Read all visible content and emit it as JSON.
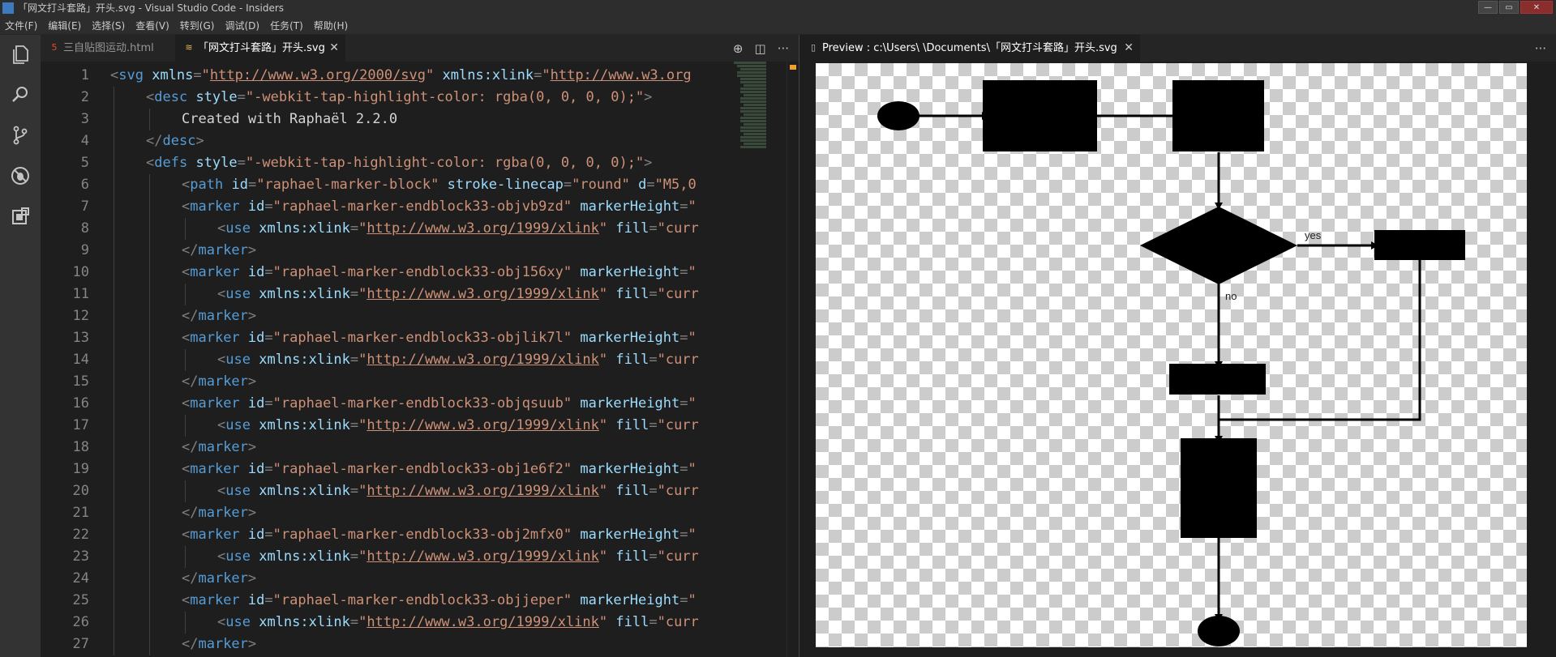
{
  "window": {
    "title": "「网文打斗套路」开头.svg - Visual Studio Code - Insiders",
    "buttons": [
      "—",
      "▭",
      "✕"
    ]
  },
  "menu": [
    "文件(F)",
    "编辑(E)",
    "选择(S)",
    "查看(V)",
    "转到(G)",
    "调试(D)",
    "任务(T)",
    "帮助(H)"
  ],
  "activity_icons": [
    "files-icon",
    "search-icon",
    "source-control-icon",
    "debug-icon",
    "extensions-icon"
  ],
  "editor": {
    "tabs": [
      {
        "label": "三自贴图运动.html",
        "icon": "html5-icon",
        "active": false
      },
      {
        "label": "「网文打斗套路」开头.svg",
        "icon": "svg-file-icon",
        "active": true
      }
    ],
    "actions": [
      "⊕",
      "◫",
      "···"
    ],
    "lines": [
      {
        "n": "1",
        "indent": 0,
        "tokens": [
          [
            "pun",
            "<"
          ],
          [
            "tag",
            "svg"
          ],
          [
            "txt",
            " "
          ],
          [
            "attr",
            "xmlns"
          ],
          [
            "pun",
            "="
          ],
          [
            "str",
            "\""
          ],
          [
            "url",
            "http://www.w3.org/2000/svg"
          ],
          [
            "str",
            "\""
          ],
          [
            "txt",
            " "
          ],
          [
            "attr",
            "xmlns:xlink"
          ],
          [
            "pun",
            "="
          ],
          [
            "str",
            "\""
          ],
          [
            "url",
            "http://www.w3.org"
          ]
        ]
      },
      {
        "n": "2",
        "indent": 1,
        "tokens": [
          [
            "pun",
            "<"
          ],
          [
            "tag",
            "desc"
          ],
          [
            "txt",
            " "
          ],
          [
            "attr",
            "style"
          ],
          [
            "pun",
            "="
          ],
          [
            "str",
            "\"-webkit-tap-highlight-color: rgba(0, 0, 0, 0);\""
          ],
          [
            "pun",
            ">"
          ]
        ]
      },
      {
        "n": "3",
        "indent": 2,
        "tokens": [
          [
            "txt",
            "Created with Raphaël 2.2.0"
          ]
        ]
      },
      {
        "n": "4",
        "indent": 1,
        "tokens": [
          [
            "pun",
            "</"
          ],
          [
            "tag",
            "desc"
          ],
          [
            "pun",
            ">"
          ]
        ]
      },
      {
        "n": "5",
        "indent": 1,
        "tokens": [
          [
            "pun",
            "<"
          ],
          [
            "tag",
            "defs"
          ],
          [
            "txt",
            " "
          ],
          [
            "attr",
            "style"
          ],
          [
            "pun",
            "="
          ],
          [
            "str",
            "\"-webkit-tap-highlight-color: rgba(0, 0, 0, 0);\""
          ],
          [
            "pun",
            ">"
          ]
        ]
      },
      {
        "n": "6",
        "indent": 2,
        "tokens": [
          [
            "pun",
            "<"
          ],
          [
            "tag",
            "path"
          ],
          [
            "txt",
            " "
          ],
          [
            "attr",
            "id"
          ],
          [
            "pun",
            "="
          ],
          [
            "str",
            "\"raphael-marker-block\""
          ],
          [
            "txt",
            " "
          ],
          [
            "attr",
            "stroke-linecap"
          ],
          [
            "pun",
            "="
          ],
          [
            "str",
            "\"round\""
          ],
          [
            "txt",
            " "
          ],
          [
            "attr",
            "d"
          ],
          [
            "pun",
            "="
          ],
          [
            "str",
            "\"M5,0"
          ]
        ]
      },
      {
        "n": "7",
        "indent": 2,
        "tokens": [
          [
            "pun",
            "<"
          ],
          [
            "tag",
            "marker"
          ],
          [
            "txt",
            " "
          ],
          [
            "attr",
            "id"
          ],
          [
            "pun",
            "="
          ],
          [
            "str",
            "\"raphael-marker-endblock33-objvb9zd\""
          ],
          [
            "txt",
            " "
          ],
          [
            "attr",
            "markerHeight"
          ],
          [
            "pun",
            "="
          ],
          [
            "str",
            "\""
          ]
        ]
      },
      {
        "n": "8",
        "indent": 3,
        "tokens": [
          [
            "pun",
            "<"
          ],
          [
            "tag",
            "use"
          ],
          [
            "txt",
            " "
          ],
          [
            "attr",
            "xmlns:xlink"
          ],
          [
            "pun",
            "="
          ],
          [
            "str",
            "\""
          ],
          [
            "url",
            "http://www.w3.org/1999/xlink"
          ],
          [
            "str",
            "\""
          ],
          [
            "txt",
            " "
          ],
          [
            "attr",
            "fill"
          ],
          [
            "pun",
            "="
          ],
          [
            "str",
            "\"curr"
          ]
        ]
      },
      {
        "n": "9",
        "indent": 2,
        "tokens": [
          [
            "pun",
            "</"
          ],
          [
            "tag",
            "marker"
          ],
          [
            "pun",
            ">"
          ]
        ]
      },
      {
        "n": "10",
        "indent": 2,
        "tokens": [
          [
            "pun",
            "<"
          ],
          [
            "tag",
            "marker"
          ],
          [
            "txt",
            " "
          ],
          [
            "attr",
            "id"
          ],
          [
            "pun",
            "="
          ],
          [
            "str",
            "\"raphael-marker-endblock33-obj156xy\""
          ],
          [
            "txt",
            " "
          ],
          [
            "attr",
            "markerHeight"
          ],
          [
            "pun",
            "="
          ],
          [
            "str",
            "\""
          ]
        ]
      },
      {
        "n": "11",
        "indent": 3,
        "tokens": [
          [
            "pun",
            "<"
          ],
          [
            "tag",
            "use"
          ],
          [
            "txt",
            " "
          ],
          [
            "attr",
            "xmlns:xlink"
          ],
          [
            "pun",
            "="
          ],
          [
            "str",
            "\""
          ],
          [
            "url",
            "http://www.w3.org/1999/xlink"
          ],
          [
            "str",
            "\""
          ],
          [
            "txt",
            " "
          ],
          [
            "attr",
            "fill"
          ],
          [
            "pun",
            "="
          ],
          [
            "str",
            "\"curr"
          ]
        ]
      },
      {
        "n": "12",
        "indent": 2,
        "tokens": [
          [
            "pun",
            "</"
          ],
          [
            "tag",
            "marker"
          ],
          [
            "pun",
            ">"
          ]
        ]
      },
      {
        "n": "13",
        "indent": 2,
        "tokens": [
          [
            "pun",
            "<"
          ],
          [
            "tag",
            "marker"
          ],
          [
            "txt",
            " "
          ],
          [
            "attr",
            "id"
          ],
          [
            "pun",
            "="
          ],
          [
            "str",
            "\"raphael-marker-endblock33-objlik7l\""
          ],
          [
            "txt",
            " "
          ],
          [
            "attr",
            "markerHeight"
          ],
          [
            "pun",
            "="
          ],
          [
            "str",
            "\""
          ]
        ]
      },
      {
        "n": "14",
        "indent": 3,
        "tokens": [
          [
            "pun",
            "<"
          ],
          [
            "tag",
            "use"
          ],
          [
            "txt",
            " "
          ],
          [
            "attr",
            "xmlns:xlink"
          ],
          [
            "pun",
            "="
          ],
          [
            "str",
            "\""
          ],
          [
            "url",
            "http://www.w3.org/1999/xlink"
          ],
          [
            "str",
            "\""
          ],
          [
            "txt",
            " "
          ],
          [
            "attr",
            "fill"
          ],
          [
            "pun",
            "="
          ],
          [
            "str",
            "\"curr"
          ]
        ]
      },
      {
        "n": "15",
        "indent": 2,
        "tokens": [
          [
            "pun",
            "</"
          ],
          [
            "tag",
            "marker"
          ],
          [
            "pun",
            ">"
          ]
        ]
      },
      {
        "n": "16",
        "indent": 2,
        "tokens": [
          [
            "pun",
            "<"
          ],
          [
            "tag",
            "marker"
          ],
          [
            "txt",
            " "
          ],
          [
            "attr",
            "id"
          ],
          [
            "pun",
            "="
          ],
          [
            "str",
            "\"raphael-marker-endblock33-objqsuub\""
          ],
          [
            "txt",
            " "
          ],
          [
            "attr",
            "markerHeight"
          ],
          [
            "pun",
            "="
          ],
          [
            "str",
            "\""
          ]
        ]
      },
      {
        "n": "17",
        "indent": 3,
        "tokens": [
          [
            "pun",
            "<"
          ],
          [
            "tag",
            "use"
          ],
          [
            "txt",
            " "
          ],
          [
            "attr",
            "xmlns:xlink"
          ],
          [
            "pun",
            "="
          ],
          [
            "str",
            "\""
          ],
          [
            "url",
            "http://www.w3.org/1999/xlink"
          ],
          [
            "str",
            "\""
          ],
          [
            "txt",
            " "
          ],
          [
            "attr",
            "fill"
          ],
          [
            "pun",
            "="
          ],
          [
            "str",
            "\"curr"
          ]
        ]
      },
      {
        "n": "18",
        "indent": 2,
        "tokens": [
          [
            "pun",
            "</"
          ],
          [
            "tag",
            "marker"
          ],
          [
            "pun",
            ">"
          ]
        ]
      },
      {
        "n": "19",
        "indent": 2,
        "tokens": [
          [
            "pun",
            "<"
          ],
          [
            "tag",
            "marker"
          ],
          [
            "txt",
            " "
          ],
          [
            "attr",
            "id"
          ],
          [
            "pun",
            "="
          ],
          [
            "str",
            "\"raphael-marker-endblock33-obj1e6f2\""
          ],
          [
            "txt",
            " "
          ],
          [
            "attr",
            "markerHeight"
          ],
          [
            "pun",
            "="
          ],
          [
            "str",
            "\""
          ]
        ]
      },
      {
        "n": "20",
        "indent": 3,
        "tokens": [
          [
            "pun",
            "<"
          ],
          [
            "tag",
            "use"
          ],
          [
            "txt",
            " "
          ],
          [
            "attr",
            "xmlns:xlink"
          ],
          [
            "pun",
            "="
          ],
          [
            "str",
            "\""
          ],
          [
            "url",
            "http://www.w3.org/1999/xlink"
          ],
          [
            "str",
            "\""
          ],
          [
            "txt",
            " "
          ],
          [
            "attr",
            "fill"
          ],
          [
            "pun",
            "="
          ],
          [
            "str",
            "\"curr"
          ]
        ]
      },
      {
        "n": "21",
        "indent": 2,
        "tokens": [
          [
            "pun",
            "</"
          ],
          [
            "tag",
            "marker"
          ],
          [
            "pun",
            ">"
          ]
        ]
      },
      {
        "n": "22",
        "indent": 2,
        "tokens": [
          [
            "pun",
            "<"
          ],
          [
            "tag",
            "marker"
          ],
          [
            "txt",
            " "
          ],
          [
            "attr",
            "id"
          ],
          [
            "pun",
            "="
          ],
          [
            "str",
            "\"raphael-marker-endblock33-obj2mfx0\""
          ],
          [
            "txt",
            " "
          ],
          [
            "attr",
            "markerHeight"
          ],
          [
            "pun",
            "="
          ],
          [
            "str",
            "\""
          ]
        ]
      },
      {
        "n": "23",
        "indent": 3,
        "tokens": [
          [
            "pun",
            "<"
          ],
          [
            "tag",
            "use"
          ],
          [
            "txt",
            " "
          ],
          [
            "attr",
            "xmlns:xlink"
          ],
          [
            "pun",
            "="
          ],
          [
            "str",
            "\""
          ],
          [
            "url",
            "http://www.w3.org/1999/xlink"
          ],
          [
            "str",
            "\""
          ],
          [
            "txt",
            " "
          ],
          [
            "attr",
            "fill"
          ],
          [
            "pun",
            "="
          ],
          [
            "str",
            "\"curr"
          ]
        ]
      },
      {
        "n": "24",
        "indent": 2,
        "tokens": [
          [
            "pun",
            "</"
          ],
          [
            "tag",
            "marker"
          ],
          [
            "pun",
            ">"
          ]
        ]
      },
      {
        "n": "25",
        "indent": 2,
        "tokens": [
          [
            "pun",
            "<"
          ],
          [
            "tag",
            "marker"
          ],
          [
            "txt",
            " "
          ],
          [
            "attr",
            "id"
          ],
          [
            "pun",
            "="
          ],
          [
            "str",
            "\"raphael-marker-endblock33-objjeper\""
          ],
          [
            "txt",
            " "
          ],
          [
            "attr",
            "markerHeight"
          ],
          [
            "pun",
            "="
          ],
          [
            "str",
            "\""
          ]
        ]
      },
      {
        "n": "26",
        "indent": 3,
        "tokens": [
          [
            "pun",
            "<"
          ],
          [
            "tag",
            "use"
          ],
          [
            "txt",
            " "
          ],
          [
            "attr",
            "xmlns:xlink"
          ],
          [
            "pun",
            "="
          ],
          [
            "str",
            "\""
          ],
          [
            "url",
            "http://www.w3.org/1999/xlink"
          ],
          [
            "str",
            "\""
          ],
          [
            "txt",
            " "
          ],
          [
            "attr",
            "fill"
          ],
          [
            "pun",
            "="
          ],
          [
            "str",
            "\"curr"
          ]
        ]
      },
      {
        "n": "27",
        "indent": 2,
        "tokens": [
          [
            "pun",
            "</"
          ],
          [
            "tag",
            "marker"
          ],
          [
            "pun",
            ">"
          ]
        ]
      }
    ]
  },
  "preview": {
    "tab_label": "Preview : c:\\Users\\        \\Documents\\「网文打斗套路」开头.svg",
    "tab_actions": [
      "···"
    ],
    "flow_labels": {
      "yes": "yes",
      "no": "no"
    }
  }
}
